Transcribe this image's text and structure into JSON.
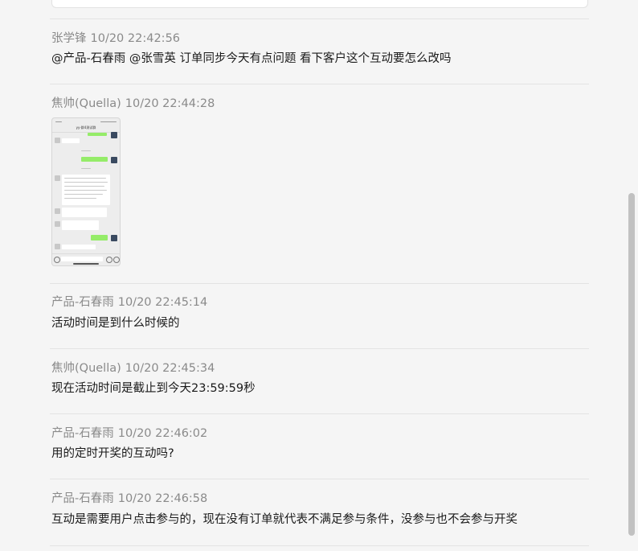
{
  "messages": [
    {
      "sender": "张学锋",
      "time": "10/20 22:42:56",
      "text": "@产品-石春雨  @张雪英  订单同步今天有点问题 看下客户这个互动要怎么改吗"
    },
    {
      "sender": "焦帅(Quella)",
      "time": "10/20 22:44:28",
      "image": {
        "type": "chat-screenshot-thumbnail",
        "header_title": "yy-群4测试群"
      }
    },
    {
      "sender": "产品-石春雨",
      "time": "10/20 22:45:14",
      "text": "活动时间是到什么时候的"
    },
    {
      "sender": "焦帅(Quella)",
      "time": "10/20 22:45:34",
      "text": "现在活动时间是截止到今天23:59:59秒"
    },
    {
      "sender": "产品-石春雨",
      "time": "10/20 22:46:02",
      "text": "用的定时开奖的互动吗?"
    },
    {
      "sender": "产品-石春雨",
      "time": "10/20 22:46:58",
      "text": "互动是需要用户点击参与的，现在没有订单就代表不满足参与条件，没参与也不会参与开奖"
    }
  ],
  "colors": {
    "background": "#f5f5f5",
    "meta_text": "#8a8a8a",
    "body_text": "#1a1a1a",
    "divider": "#e3e3e3",
    "scrollbar": "#c1c1c1"
  },
  "scroll": {
    "position_fraction": 0.35
  }
}
